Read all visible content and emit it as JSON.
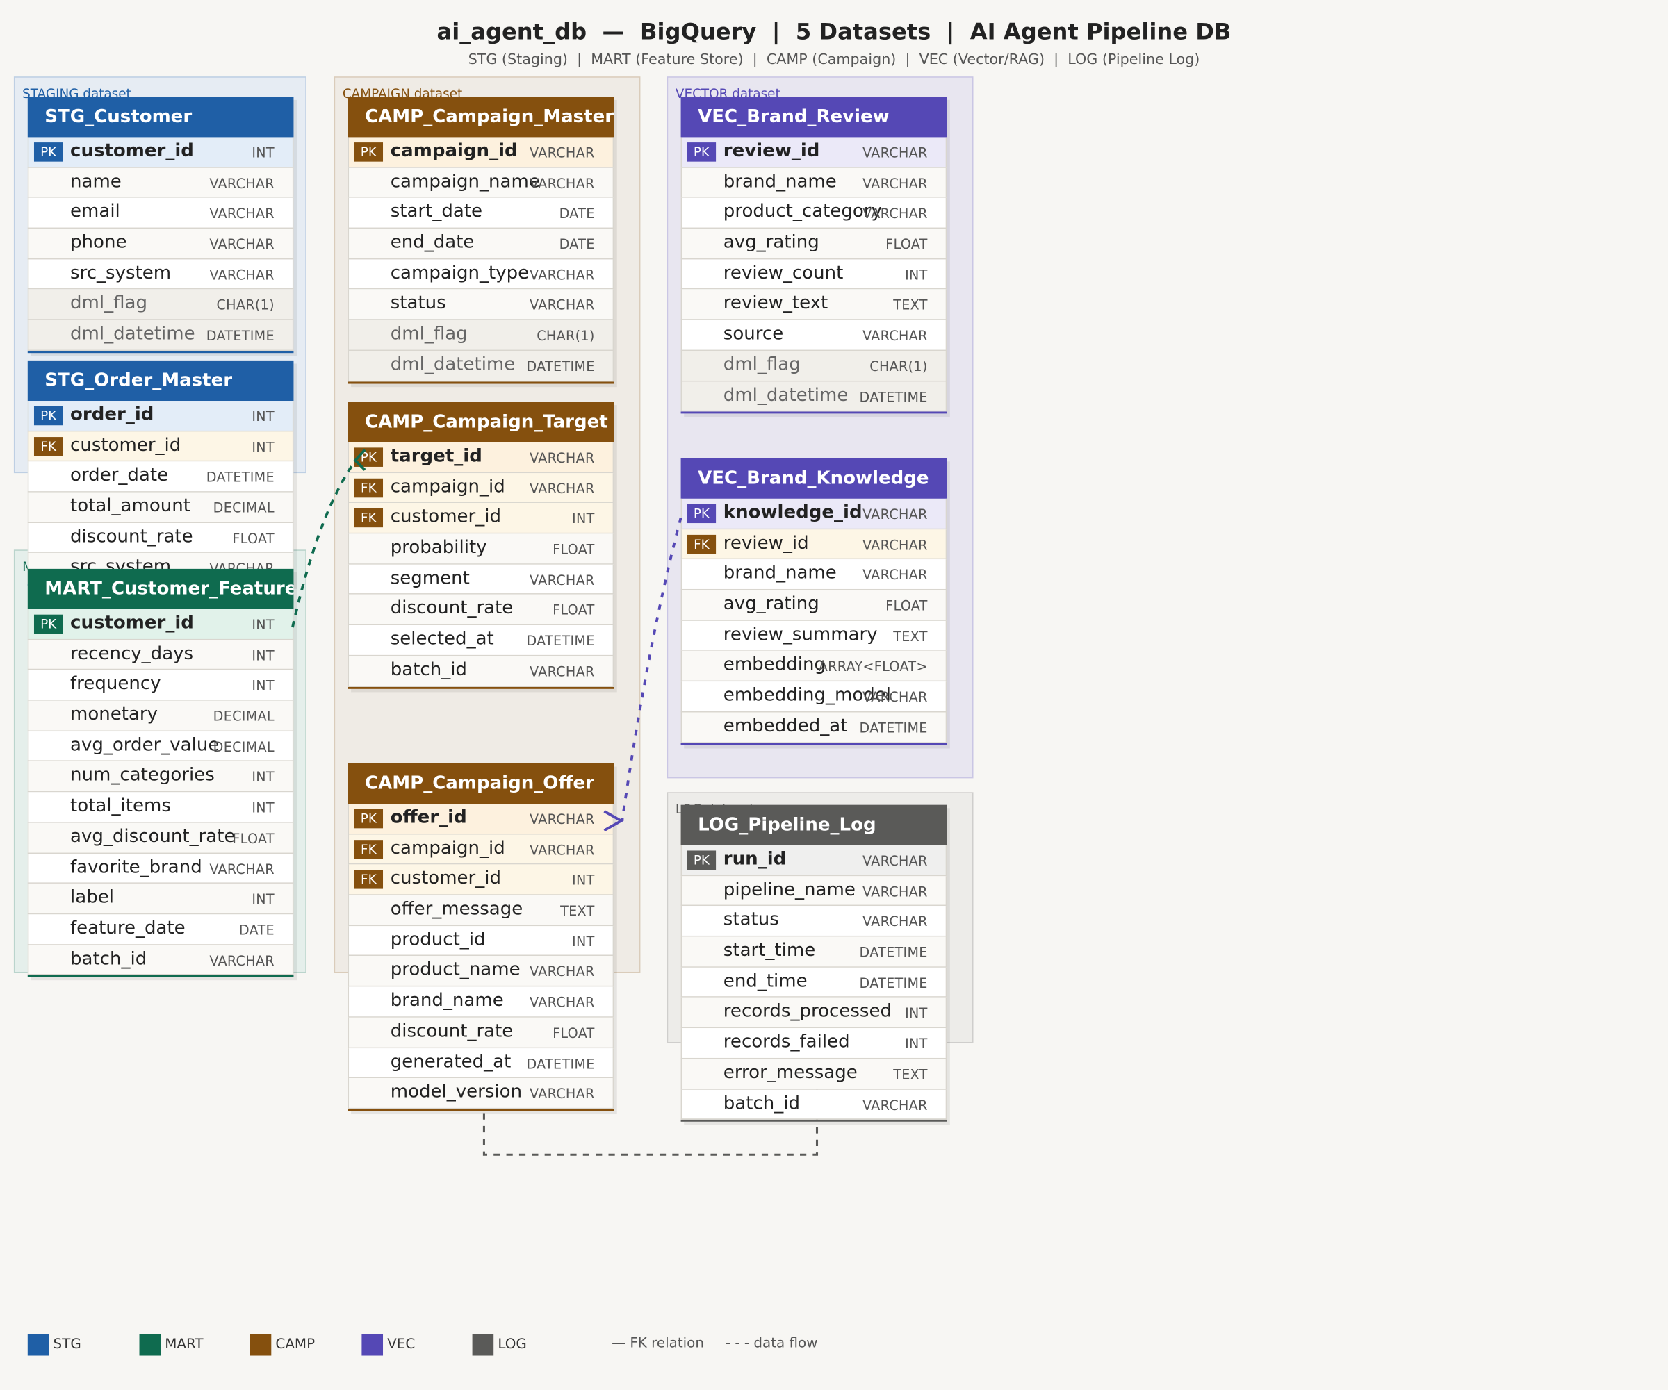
{
  "header": {
    "title": "ai_agent_db  —  BigQuery  |  5 Datasets  |  AI Agent Pipeline DB",
    "subtitle": "STG (Staging)  |  MART (Feature Store)  |  CAMP (Campaign)  |  VEC (Vector/RAG)  |  LOG (Pipeline Log)"
  },
  "colors": {
    "STG": "#1f5fa6",
    "MART": "#0f6b4f",
    "CAMP": "#85500e",
    "VEC": "#5548b5",
    "LOG": "#5a5a58"
  },
  "datasets": [
    {
      "id": "staging",
      "label": "STAGING dataset",
      "color": "STG"
    },
    {
      "id": "mart",
      "label": "MART dataset",
      "color": "MART"
    },
    {
      "id": "campaign",
      "label": "CAMPAIGN dataset",
      "color": "CAMP"
    },
    {
      "id": "vector",
      "label": "VECTOR dataset",
      "color": "VEC"
    },
    {
      "id": "log",
      "label": "LOG dataset",
      "color": "LOG"
    }
  ],
  "tables": [
    {
      "id": "stg_customer",
      "name": "STG_Customer",
      "color": "STG",
      "columns": [
        {
          "key": "PK",
          "name": "customer_id",
          "type": "INT"
        },
        {
          "name": "name",
          "type": "VARCHAR"
        },
        {
          "name": "email",
          "type": "VARCHAR"
        },
        {
          "name": "phone",
          "type": "VARCHAR"
        },
        {
          "name": "src_system",
          "type": "VARCHAR"
        },
        {
          "name": "dml_flag",
          "type": "CHAR(1)",
          "meta": true
        },
        {
          "name": "dml_datetime",
          "type": "DATETIME",
          "meta": true
        }
      ]
    },
    {
      "id": "stg_order_master",
      "name": "STG_Order_Master",
      "color": "STG",
      "columns": [
        {
          "key": "PK",
          "name": "order_id",
          "type": "INT"
        },
        {
          "key": "FK",
          "name": "customer_id",
          "type": "INT"
        },
        {
          "name": "order_date",
          "type": "DATETIME"
        },
        {
          "name": "total_amount",
          "type": "DECIMAL"
        },
        {
          "name": "discount_rate",
          "type": "FLOAT"
        },
        {
          "name": "src_system",
          "type": "VARCHAR"
        }
      ]
    },
    {
      "id": "mart_customer_feature",
      "name": "MART_Customer_Feature",
      "color": "MART",
      "columns": [
        {
          "key": "PK",
          "name": "customer_id",
          "type": "INT"
        },
        {
          "name": "recency_days",
          "type": "INT"
        },
        {
          "name": "frequency",
          "type": "INT"
        },
        {
          "name": "monetary",
          "type": "DECIMAL"
        },
        {
          "name": "avg_order_value",
          "type": "DECIMAL"
        },
        {
          "name": "num_categories",
          "type": "INT"
        },
        {
          "name": "total_items",
          "type": "INT"
        },
        {
          "name": "avg_discount_rate",
          "type": "FLOAT"
        },
        {
          "name": "favorite_brand",
          "type": "VARCHAR"
        },
        {
          "name": "label",
          "type": "INT"
        },
        {
          "name": "feature_date",
          "type": "DATE"
        },
        {
          "name": "batch_id",
          "type": "VARCHAR"
        }
      ]
    },
    {
      "id": "camp_campaign_master",
      "name": "CAMP_Campaign_Master",
      "color": "CAMP",
      "columns": [
        {
          "key": "PK",
          "name": "campaign_id",
          "type": "VARCHAR"
        },
        {
          "name": "campaign_name",
          "type": "VARCHAR"
        },
        {
          "name": "start_date",
          "type": "DATE"
        },
        {
          "name": "end_date",
          "type": "DATE"
        },
        {
          "name": "campaign_type",
          "type": "VARCHAR"
        },
        {
          "name": "status",
          "type": "VARCHAR"
        },
        {
          "name": "dml_flag",
          "type": "CHAR(1)",
          "meta": true
        },
        {
          "name": "dml_datetime",
          "type": "DATETIME",
          "meta": true
        }
      ]
    },
    {
      "id": "camp_campaign_target",
      "name": "CAMP_Campaign_Target",
      "color": "CAMP",
      "columns": [
        {
          "key": "PK",
          "name": "target_id",
          "type": "VARCHAR"
        },
        {
          "key": "FK",
          "name": "campaign_id",
          "type": "VARCHAR"
        },
        {
          "key": "FK",
          "name": "customer_id",
          "type": "INT"
        },
        {
          "name": "probability",
          "type": "FLOAT"
        },
        {
          "name": "segment",
          "type": "VARCHAR"
        },
        {
          "name": "discount_rate",
          "type": "FLOAT"
        },
        {
          "name": "selected_at",
          "type": "DATETIME"
        },
        {
          "name": "batch_id",
          "type": "VARCHAR"
        }
      ]
    },
    {
      "id": "camp_campaign_offer",
      "name": "CAMP_Campaign_Offer",
      "color": "CAMP",
      "columns": [
        {
          "key": "PK",
          "name": "offer_id",
          "type": "VARCHAR"
        },
        {
          "key": "FK",
          "name": "campaign_id",
          "type": "VARCHAR"
        },
        {
          "key": "FK",
          "name": "customer_id",
          "type": "INT"
        },
        {
          "name": "offer_message",
          "type": "TEXT"
        },
        {
          "name": "product_id",
          "type": "INT"
        },
        {
          "name": "product_name",
          "type": "VARCHAR"
        },
        {
          "name": "brand_name",
          "type": "VARCHAR"
        },
        {
          "name": "discount_rate",
          "type": "FLOAT"
        },
        {
          "name": "generated_at",
          "type": "DATETIME"
        },
        {
          "name": "model_version",
          "type": "VARCHAR"
        }
      ]
    },
    {
      "id": "vec_brand_review",
      "name": "VEC_Brand_Review",
      "color": "VEC",
      "columns": [
        {
          "key": "PK",
          "name": "review_id",
          "type": "VARCHAR"
        },
        {
          "name": "brand_name",
          "type": "VARCHAR"
        },
        {
          "name": "product_category",
          "type": "VARCHAR"
        },
        {
          "name": "avg_rating",
          "type": "FLOAT"
        },
        {
          "name": "review_count",
          "type": "INT"
        },
        {
          "name": "review_text",
          "type": "TEXT"
        },
        {
          "name": "source",
          "type": "VARCHAR"
        },
        {
          "name": "dml_flag",
          "type": "CHAR(1)",
          "meta": true
        },
        {
          "name": "dml_datetime",
          "type": "DATETIME",
          "meta": true
        }
      ]
    },
    {
      "id": "vec_brand_knowledge",
      "name": "VEC_Brand_Knowledge",
      "color": "VEC",
      "columns": [
        {
          "key": "PK",
          "name": "knowledge_id",
          "type": "VARCHAR"
        },
        {
          "key": "FK",
          "name": "review_id",
          "type": "VARCHAR"
        },
        {
          "name": "brand_name",
          "type": "VARCHAR"
        },
        {
          "name": "avg_rating",
          "type": "FLOAT"
        },
        {
          "name": "review_summary",
          "type": "TEXT"
        },
        {
          "name": "embedding",
          "type": "ARRAY<FLOAT>"
        },
        {
          "name": "embedding_model",
          "type": "VARCHAR"
        },
        {
          "name": "embedded_at",
          "type": "DATETIME"
        }
      ]
    },
    {
      "id": "log_pipeline_log",
      "name": "LOG_Pipeline_Log",
      "color": "LOG",
      "columns": [
        {
          "key": "PK",
          "name": "run_id",
          "type": "VARCHAR"
        },
        {
          "name": "pipeline_name",
          "type": "VARCHAR"
        },
        {
          "name": "status",
          "type": "VARCHAR"
        },
        {
          "name": "start_time",
          "type": "DATETIME"
        },
        {
          "name": "end_time",
          "type": "DATETIME"
        },
        {
          "name": "records_processed",
          "type": "INT"
        },
        {
          "name": "records_failed",
          "type": "INT"
        },
        {
          "name": "error_message",
          "type": "TEXT"
        },
        {
          "name": "batch_id",
          "type": "VARCHAR"
        }
      ]
    }
  ],
  "legend": {
    "items": [
      {
        "label": "STG",
        "color": "STG"
      },
      {
        "label": "MART",
        "color": "MART"
      },
      {
        "label": "CAMP",
        "color": "CAMP"
      },
      {
        "label": "VEC",
        "color": "VEC"
      },
      {
        "label": "LOG",
        "color": "LOG"
      }
    ],
    "fk_relation": "— FK relation",
    "data_flow": "- - - data flow"
  }
}
